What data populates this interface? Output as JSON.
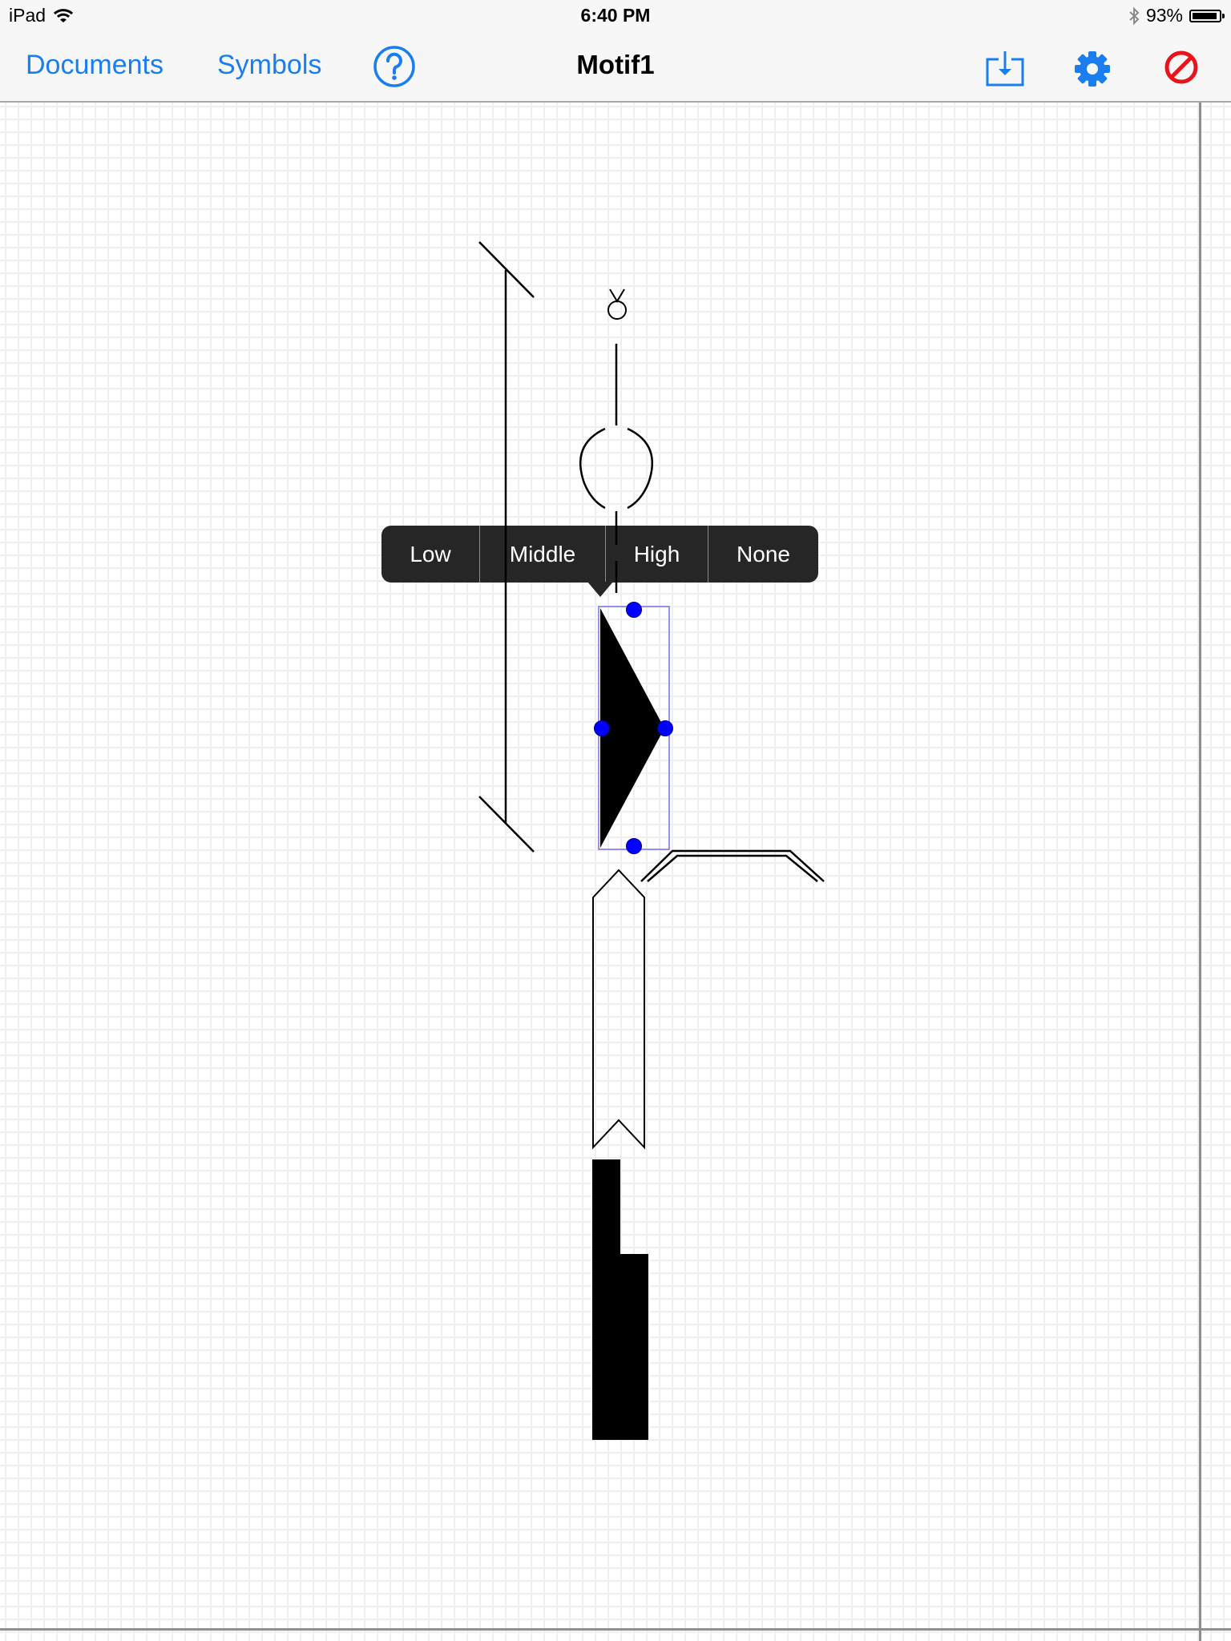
{
  "status_bar": {
    "device": "iPad",
    "wifi_icon": "wifi-icon",
    "time": "6:40 PM",
    "bluetooth_icon": "bluetooth-icon",
    "battery_percent": "93%",
    "battery_level": 0.93
  },
  "nav": {
    "documents_label": "Documents",
    "symbols_label": "Symbols",
    "help_icon": "question-circle-icon",
    "title": "Motif1",
    "export_icon": "download-tray-icon",
    "settings_icon": "gear-icon",
    "delete_icon": "prohibited-icon"
  },
  "colors": {
    "accent": "#1a7ef0",
    "danger": "#e8141b",
    "selection": "#7070e0",
    "handle": "#0000ff",
    "menu_bg": "#262626"
  },
  "context_menu": {
    "items": [
      {
        "label": "Low"
      },
      {
        "label": "Middle"
      },
      {
        "label": "High"
      },
      {
        "label": "None"
      }
    ]
  },
  "canvas": {
    "symbols": [
      {
        "name": "bracket-staff-symbol"
      },
      {
        "name": "taurus-symbol",
        "glyph": "♉"
      },
      {
        "name": "vertical-line-symbol"
      },
      {
        "name": "ellipse-parenthesis-symbol"
      },
      {
        "name": "wedge-triangle-symbol",
        "selected": true
      },
      {
        "name": "double-line-bracket-symbol"
      },
      {
        "name": "ribbon-pentagon-symbol"
      },
      {
        "name": "black-step-block-symbol"
      }
    ]
  }
}
